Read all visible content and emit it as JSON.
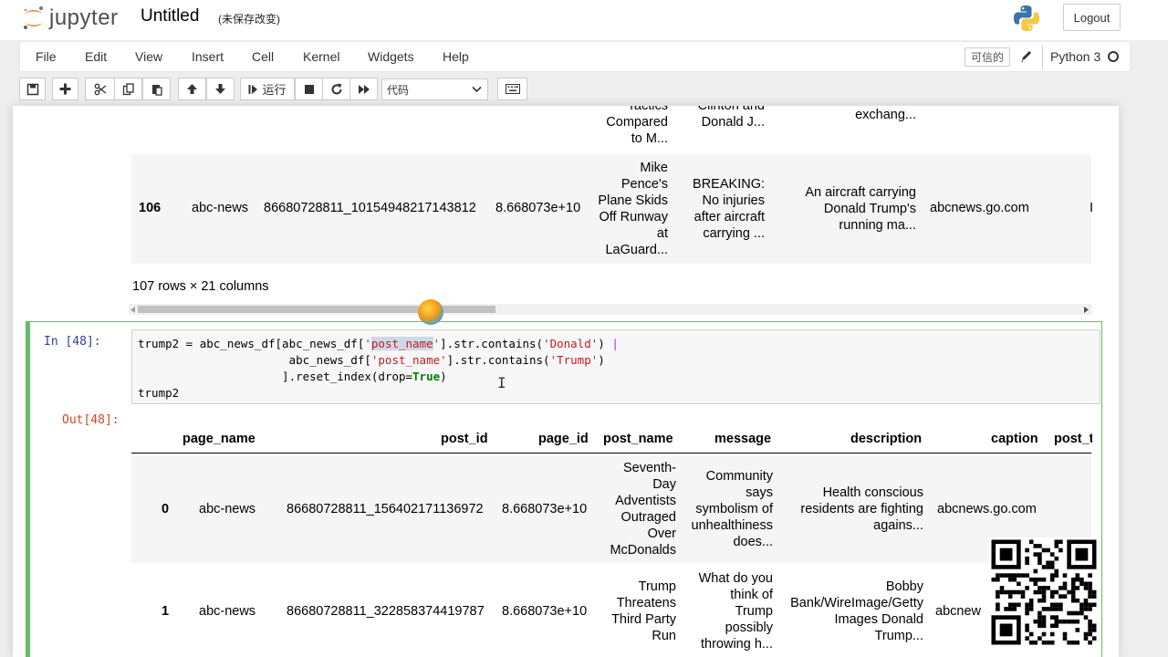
{
  "header": {
    "logo_text": "jupyter",
    "notebook_title": "Untitled",
    "save_status": "(未保存改变)",
    "logout_label": "Logout"
  },
  "menubar": {
    "items": [
      "File",
      "Edit",
      "View",
      "Insert",
      "Cell",
      "Kernel",
      "Widgets",
      "Help"
    ],
    "trusted_label": "可信的",
    "kernel_name": "Python 3"
  },
  "toolbar": {
    "run_label": "运行",
    "cell_type_value": "代码"
  },
  "prev_output": {
    "row105_tail": {
      "post_name_lines": [
        "Tactics",
        "Compared",
        "to M..."
      ],
      "message_lines": [
        "Clinton and",
        "Donald J..."
      ],
      "description_lines": [
        "exchang..."
      ]
    },
    "row106": {
      "index": "106",
      "page_name": "abc-news",
      "post_id": "86680728811_10154948217143812",
      "page_id": "8.668073e+10",
      "post_name_lines": [
        "Mike",
        "Pence's",
        "Plane Skids",
        "Off Runway",
        "at",
        "LaGuard..."
      ],
      "message_lines": [
        "BREAKING:",
        "No injuries",
        "after aircraft",
        "carrying ..."
      ],
      "description_lines": [
        "An aircraft carrying",
        "Donald Trump's",
        "running ma..."
      ],
      "caption": "abcnews.go.com",
      "trailing": "I"
    },
    "rows_info": "107 rows × 21 columns"
  },
  "cell48": {
    "in_prompt": "In  [48]:",
    "out_prompt": "Out[48]:",
    "code_lines": [
      "trump2 = abc_news_df[abc_news_df['post_name'].str.contains('Donald') |",
      "                      abc_news_df['post_name'].str.contains('Trump')",
      "                     ].reset_index(drop=True)",
      "trump2"
    ]
  },
  "output_table": {
    "columns": [
      "page_name",
      "post_id",
      "page_id",
      "post_name",
      "message",
      "description",
      "caption",
      "post_t"
    ],
    "rows": [
      {
        "index": "0",
        "page_name": "abc-news",
        "post_id": "86680728811_156402171136972",
        "page_id": "8.668073e+10",
        "post_name_lines": [
          "Seventh-",
          "Day",
          "Adventists",
          "Outraged",
          "Over",
          "McDonalds"
        ],
        "message_lines": [
          "Community",
          "says",
          "symbolism of",
          "unhealthiness",
          "does..."
        ],
        "description_lines": [
          "Health conscious",
          "residents are fighting",
          "agains..."
        ],
        "caption": "abcnews.go.com"
      },
      {
        "index": "1",
        "page_name": "abc-news",
        "post_id": "86680728811_322858374419787",
        "page_id": "8.668073e+10",
        "post_name_lines": [
          "Trump",
          "Threatens",
          "Third Party",
          "Run"
        ],
        "message_lines": [
          "What do you",
          "think of",
          "Trump",
          "possibly",
          "throwing h..."
        ],
        "description_lines": [
          "Bobby",
          "Bank/WireImage/Getty",
          "Images Donald",
          "Trump..."
        ],
        "caption": "abcnew"
      }
    ]
  },
  "colors": {
    "edit_mode_border": "#66bb6a",
    "in_prompt": "#303f9f",
    "out_prompt": "#d84315",
    "string": "#ba2121",
    "keyword": "#008000",
    "operator": "#aa22ff"
  }
}
